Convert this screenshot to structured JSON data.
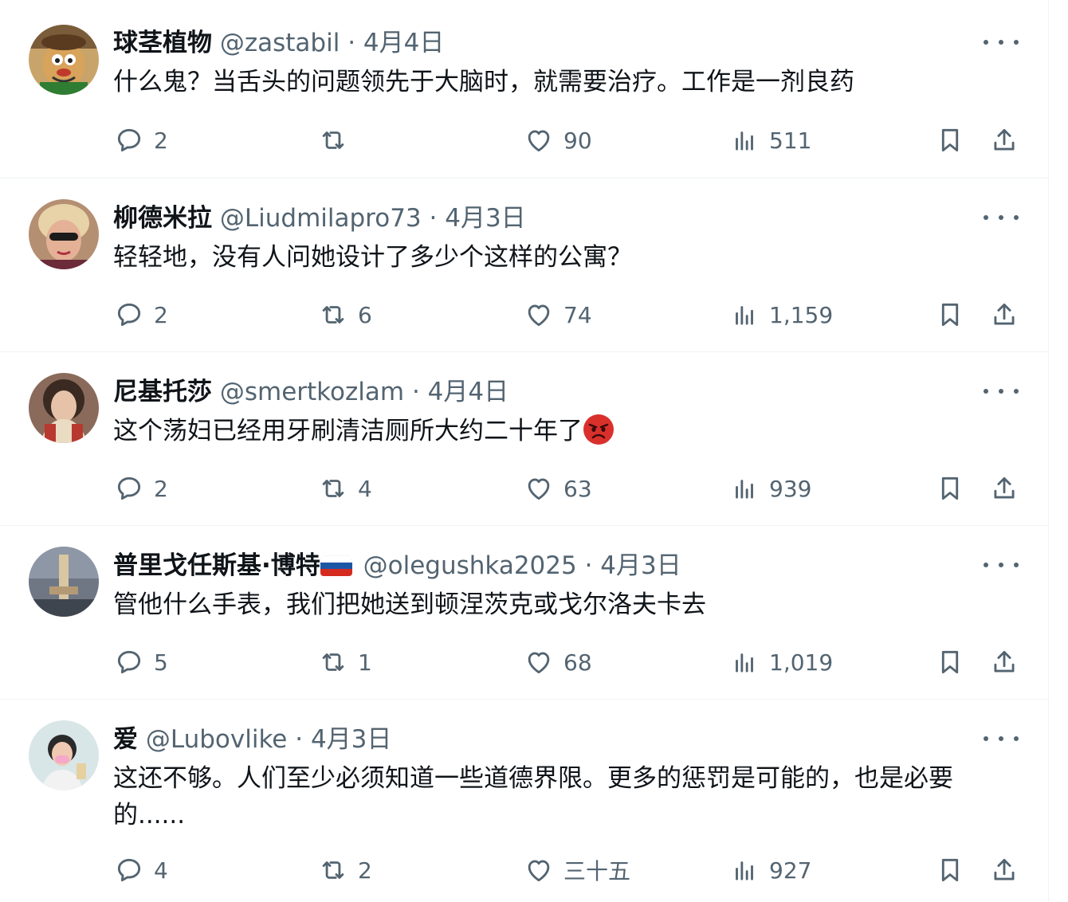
{
  "replies": [
    {
      "name": "球茎植物",
      "handle": "@zastabil",
      "separator": "·",
      "date": "4月4日",
      "text": "什么鬼？当舌头的问题领先于大脑时，就需要治疗。工作是一剂良药",
      "stats": {
        "replies": "2",
        "reposts": "",
        "likes": "90",
        "views": "511"
      }
    },
    {
      "name": "柳德米拉",
      "handle": "@Liudmilapro73",
      "separator": "·",
      "date": "4月3日",
      "text": "轻轻地，没有人问她设计了多少个这样的公寓？",
      "stats": {
        "replies": "2",
        "reposts": "6",
        "likes": "74",
        "views": "1,159"
      }
    },
    {
      "name": "尼基托莎",
      "handle": "@smertkozlam",
      "separator": "·",
      "date": "4月4日",
      "text": "这个荡妇已经用牙刷清洁厕所大约二十年了",
      "emoji": "pouting-face-icon",
      "stats": {
        "replies": "2",
        "reposts": "4",
        "likes": "63",
        "views": "939"
      }
    },
    {
      "name": "普里戈任斯基·博特",
      "flag": "russia-flag-icon",
      "handle": "@olegushka2025",
      "separator": "·",
      "date": "4月3日",
      "text": "管他什么手表，我们把她送到顿涅茨克或戈尔洛夫卡去",
      "stats": {
        "replies": "5",
        "reposts": "1",
        "likes": "68",
        "views": "1,019"
      }
    },
    {
      "name": "爱",
      "handle": "@Lubovlike",
      "separator": "·",
      "date": "4月3日",
      "text": "这还不够。人们至少必须知道一些道德界限。更多的惩罚是可能的，也是必要的......",
      "stats": {
        "replies": "4",
        "reposts": "2",
        "likes": "三十五",
        "views": "927"
      }
    }
  ],
  "colors": {
    "text_primary": "#0f1419",
    "text_secondary": "#536471",
    "divider": "#eff3f4"
  }
}
